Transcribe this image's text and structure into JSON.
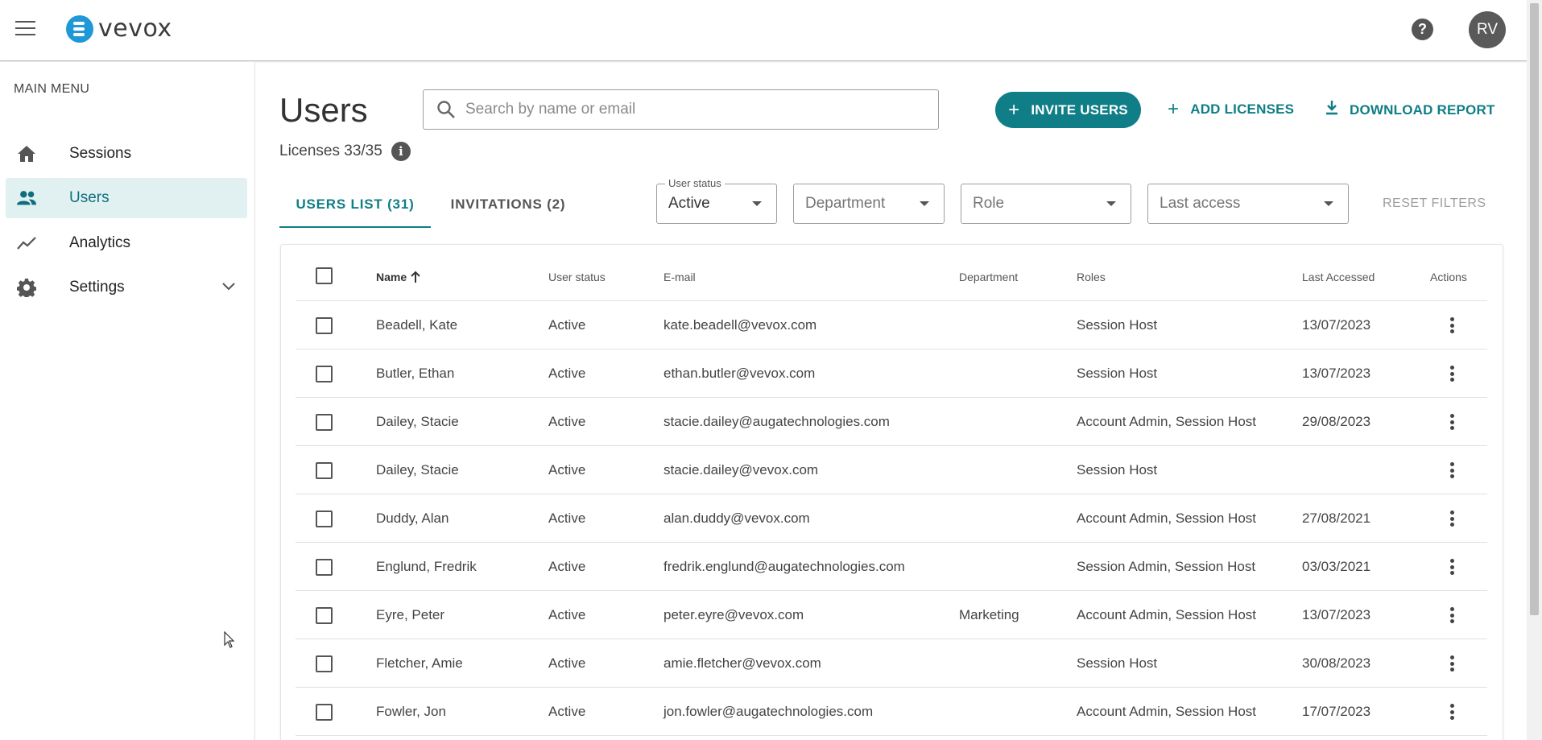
{
  "header": {
    "logo_text": "vevox",
    "avatar_initials": "RV",
    "help_icon": "?"
  },
  "sidebar": {
    "heading": "MAIN MENU",
    "items": [
      {
        "label": "Sessions",
        "icon": "home-icon"
      },
      {
        "label": "Users",
        "icon": "users-icon",
        "active": true
      },
      {
        "label": "Analytics",
        "icon": "analytics-icon"
      },
      {
        "label": "Settings",
        "icon": "gear-icon",
        "expandable": true
      }
    ]
  },
  "main": {
    "title": "Users",
    "licenses": "Licenses 33/35",
    "info_icon": "i",
    "search": {
      "placeholder": "Search by name or email"
    },
    "actions": {
      "invite": "INVITE USERS",
      "add_licenses": "ADD LICENSES",
      "download_report": "DOWNLOAD REPORT"
    },
    "tabs": [
      {
        "label": "USERS LIST (31)",
        "active": true
      },
      {
        "label": "INVITATIONS (2)",
        "active": false
      }
    ],
    "filters": {
      "user_status": {
        "label": "User status",
        "value": "Active"
      },
      "department": {
        "placeholder": "Department"
      },
      "role": {
        "placeholder": "Role"
      },
      "last_access": {
        "placeholder": "Last access"
      },
      "reset": "RESET FILTERS"
    }
  },
  "table": {
    "columns": [
      "Name",
      "User status",
      "E-mail",
      "Department",
      "Roles",
      "Last Accessed",
      "Actions"
    ],
    "rows": [
      {
        "name": "Beadell, Kate",
        "status": "Active",
        "email": "kate.beadell@vevox.com",
        "department": "",
        "roles": "Session Host",
        "last": "13/07/2023"
      },
      {
        "name": "Butler, Ethan",
        "status": "Active",
        "email": "ethan.butler@vevox.com",
        "department": "",
        "roles": "Session Host",
        "last": "13/07/2023"
      },
      {
        "name": "Dailey, Stacie",
        "status": "Active",
        "email": "stacie.dailey@augatechnologies.com",
        "department": "",
        "roles": "Account Admin, Session Host",
        "last": "29/08/2023"
      },
      {
        "name": "Dailey, Stacie",
        "status": "Active",
        "email": "stacie.dailey@vevox.com",
        "department": "",
        "roles": "Session Host",
        "last": ""
      },
      {
        "name": "Duddy, Alan",
        "status": "Active",
        "email": "alan.duddy@vevox.com",
        "department": "",
        "roles": "Account Admin, Session Host",
        "last": "27/08/2021"
      },
      {
        "name": "Englund, Fredrik",
        "status": "Active",
        "email": "fredrik.englund@augatechnologies.com",
        "department": "",
        "roles": "Session Admin, Session Host",
        "last": "03/03/2021"
      },
      {
        "name": "Eyre, Peter",
        "status": "Active",
        "email": "peter.eyre@vevox.com",
        "department": "Marketing",
        "roles": "Account Admin, Session Host",
        "last": "13/07/2023"
      },
      {
        "name": "Fletcher, Amie",
        "status": "Active",
        "email": "amie.fletcher@vevox.com",
        "department": "",
        "roles": "Session Host",
        "last": "30/08/2023"
      },
      {
        "name": "Fowler, Jon",
        "status": "Active",
        "email": "jon.fowler@augatechnologies.com",
        "department": "",
        "roles": "Account Admin, Session Host",
        "last": "17/07/2023"
      }
    ]
  },
  "colors": {
    "accent": "#0f7e86",
    "active_nav_bg": "#e1f0f1",
    "brand_blue": "#1e98d7"
  }
}
